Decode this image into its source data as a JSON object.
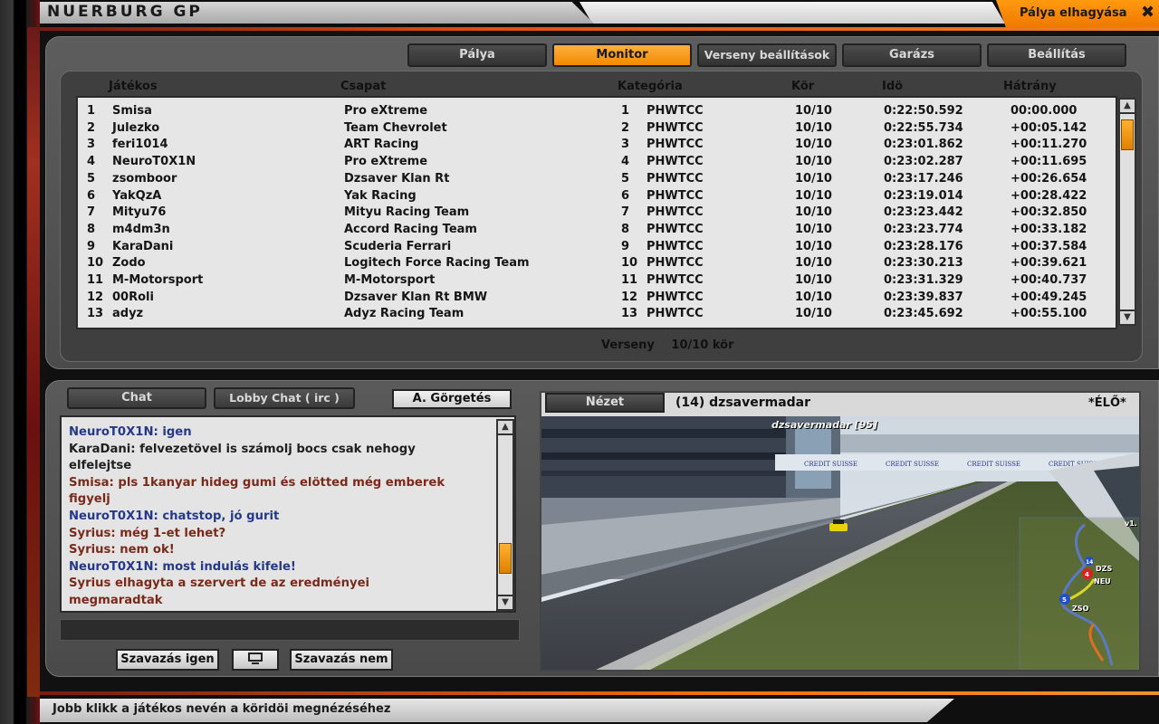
{
  "window": {
    "title": "NUERBURG GP",
    "leave_label": "Pálya elhagyása",
    "close_glyph": "✖"
  },
  "tabs": [
    {
      "label": "Pálya",
      "active": false
    },
    {
      "label": "Monitor",
      "active": true
    },
    {
      "label": "Verseny beállítások",
      "active": false
    },
    {
      "label": "Garázs",
      "active": false
    },
    {
      "label": "Beállítás",
      "active": false
    }
  ],
  "results": {
    "columns": [
      "Játékos",
      "Csapat",
      "Kategória",
      "Kör",
      "Idö",
      "Hátrány"
    ],
    "rows": [
      {
        "pos": "1",
        "player": "Smisa",
        "team": "Pro eXtreme",
        "cat_pos": "1",
        "category": "PHWTCC",
        "laps": "10/10",
        "time": "0:22:50.592",
        "gap": "00:00.000"
      },
      {
        "pos": "2",
        "player": "Julezko",
        "team": "Team Chevrolet",
        "cat_pos": "2",
        "category": "PHWTCC",
        "laps": "10/10",
        "time": "0:22:55.734",
        "gap": "+00:05.142"
      },
      {
        "pos": "3",
        "player": "feri1014",
        "team": "ART Racing",
        "cat_pos": "3",
        "category": "PHWTCC",
        "laps": "10/10",
        "time": "0:23:01.862",
        "gap": "+00:11.270"
      },
      {
        "pos": "4",
        "player": "NeuroT0X1N",
        "team": "Pro eXtreme",
        "cat_pos": "4",
        "category": "PHWTCC",
        "laps": "10/10",
        "time": "0:23:02.287",
        "gap": "+00:11.695"
      },
      {
        "pos": "5",
        "player": "zsomboor",
        "team": "Dzsaver Klan Rt",
        "cat_pos": "5",
        "category": "PHWTCC",
        "laps": "10/10",
        "time": "0:23:17.246",
        "gap": "+00:26.654"
      },
      {
        "pos": "6",
        "player": "YakQzA",
        "team": "Yak Racing",
        "cat_pos": "6",
        "category": "PHWTCC",
        "laps": "10/10",
        "time": "0:23:19.014",
        "gap": "+00:28.422"
      },
      {
        "pos": "7",
        "player": "Mityu76",
        "team": "Mityu Racing Team",
        "cat_pos": "7",
        "category": "PHWTCC",
        "laps": "10/10",
        "time": "0:23:23.442",
        "gap": "+00:32.850"
      },
      {
        "pos": "8",
        "player": "m4dm3n",
        "team": "Accord Racing Team",
        "cat_pos": "8",
        "category": "PHWTCC",
        "laps": "10/10",
        "time": "0:23:23.774",
        "gap": "+00:33.182"
      },
      {
        "pos": "9",
        "player": "KaraDani",
        "team": "Scuderia Ferrari",
        "cat_pos": "9",
        "category": "PHWTCC",
        "laps": "10/10",
        "time": "0:23:28.176",
        "gap": "+00:37.584"
      },
      {
        "pos": "10",
        "player": "Zodo",
        "team": "Logitech Force Racing Team",
        "cat_pos": "10",
        "category": "PHWTCC",
        "laps": "10/10",
        "time": "0:23:30.213",
        "gap": "+00:39.621"
      },
      {
        "pos": "11",
        "player": "M-Motorsport",
        "team": "M-Motorsport",
        "cat_pos": "11",
        "category": "PHWTCC",
        "laps": "10/10",
        "time": "0:23:31.329",
        "gap": "+00:40.737"
      },
      {
        "pos": "12",
        "player": "00Roli",
        "team": "Dzsaver Klan Rt BMW",
        "cat_pos": "12",
        "category": "PHWTCC",
        "laps": "10/10",
        "time": "0:23:39.837",
        "gap": "+00:49.245"
      },
      {
        "pos": "13",
        "player": "adyz",
        "team": "Adyz Racing Team",
        "cat_pos": "13",
        "category": "PHWTCC",
        "laps": "10/10",
        "time": "0:23:45.692",
        "gap": "+00:55.100"
      }
    ],
    "footer_session": "Verseny",
    "footer_laps": "10/10 kör"
  },
  "chat": {
    "tab_chat": "Chat",
    "tab_lobby": "Lobby Chat ( irc )",
    "autoscroll": "A. Görgetés",
    "lines": [
      {
        "text": "NeuroT0X1N: igen",
        "color": "blue"
      },
      {
        "text": "KaraDani:  felvezetövel is számolj bocs csak nehogy",
        "color": "black"
      },
      {
        "text": "elfelejtse",
        "color": "black"
      },
      {
        "text": "Smisa: pls 1kanyar hideg gumi és elötted még emberek",
        "color": "red"
      },
      {
        "text": "figyelj",
        "color": "red"
      },
      {
        "text": "NeuroT0X1N: chatstop, jó gurit",
        "color": "blue"
      },
      {
        "text": "Syrius: még 1-et lehet?",
        "color": "red"
      },
      {
        "text": "Syrius: nem ok!",
        "color": "red"
      },
      {
        "text": "NeuroT0X1N: most indulás kifele!",
        "color": "blue"
      },
      {
        "text": "Syrius elhagyta a szervert de az eredményei",
        "color": "red"
      },
      {
        "text": "megmaradtak",
        "color": "red"
      }
    ],
    "scroll_fraction": 0.85,
    "vote_yes": "Szavazás igen",
    "vote_no": "Szavazás nem"
  },
  "camera": {
    "view_label": "Nézet",
    "driver": "(14) dzsavermadar",
    "live": "*ÉLŐ*",
    "overlay_name": "dzsavermadar [95]",
    "map_version": "v1.",
    "map_markers": [
      "4",
      "5",
      "14"
    ],
    "map_tags": [
      "DZS",
      "NEU",
      "ZSO"
    ],
    "banner": "CREDIT SUISSE"
  },
  "status": {
    "hint": "Jobb klikk a játékos nevén a köridöi megnézéséhez"
  },
  "colors": {
    "accent": "#f08a00",
    "panel": "#555555",
    "list_bg": "#e6e6e6"
  }
}
